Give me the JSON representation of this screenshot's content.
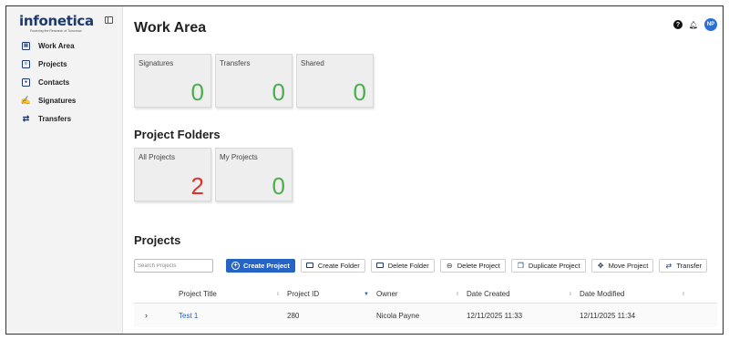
{
  "brand": {
    "logo": "infonetica",
    "tagline": "Powering the Research of Tomorrow"
  },
  "sidebar": {
    "items": [
      {
        "label": "Work Area",
        "icon": "document-icon"
      },
      {
        "label": "Projects",
        "icon": "clipboard-icon"
      },
      {
        "label": "Contacts",
        "icon": "contact-card-icon"
      },
      {
        "label": "Signatures",
        "icon": "signature-icon"
      },
      {
        "label": "Transfers",
        "icon": "transfer-arrows-icon"
      }
    ]
  },
  "header": {
    "title": "Work Area",
    "user_initials": "NP"
  },
  "summary_cards": [
    {
      "label": "Signatures",
      "count": "0"
    },
    {
      "label": "Transfers",
      "count": "0"
    },
    {
      "label": "Shared",
      "count": "0"
    }
  ],
  "project_folders": {
    "title": "Project Folders",
    "cards": [
      {
        "label": "All Projects",
        "count": "2"
      },
      {
        "label": "My Projects",
        "count": "0"
      }
    ]
  },
  "projects": {
    "title": "Projects",
    "search_placeholder": "Search Projects",
    "buttons": {
      "create_project": "Create Project",
      "create_folder": "Create Folder",
      "delete_folder": "Delete Folder",
      "delete_project": "Delete Project",
      "duplicate_project": "Duplicate Project",
      "move_project": "Move Project",
      "transfer": "Transfer"
    },
    "columns": [
      "Project Title",
      "Project ID",
      "Owner",
      "Date Created",
      "Date Modified"
    ],
    "rows": [
      {
        "title": "Test 1",
        "id": "280",
        "owner": "Nicola Payne",
        "created": "12/11/2025 11:33",
        "modified": "12/11/2025 11:34"
      }
    ]
  },
  "colors": {
    "accent": "#2563c4",
    "brand": "#1d3a6e",
    "count_green": "#4cae4c",
    "count_red": "#e0322b"
  }
}
